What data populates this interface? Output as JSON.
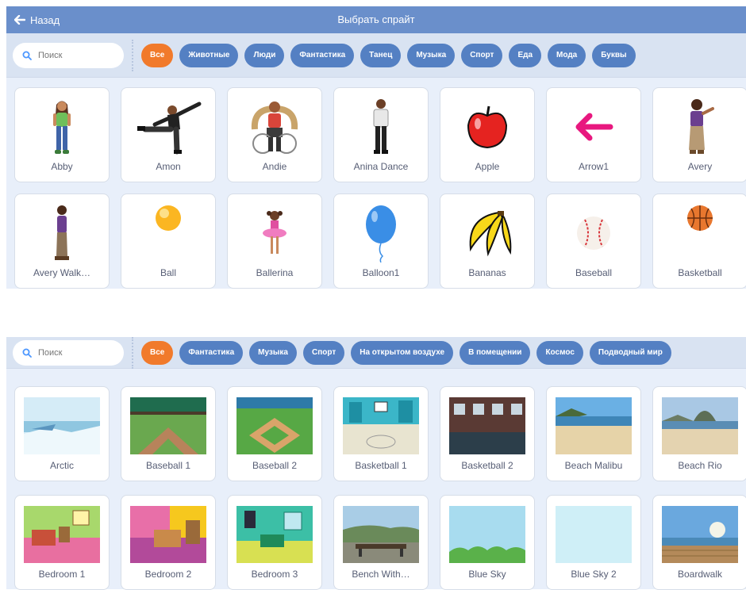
{
  "sprites_panel": {
    "back_label": "Назад",
    "title": "Выбрать спрайт",
    "search_placeholder": "Поиск",
    "tags": [
      "Все",
      "Животные",
      "Люди",
      "Фантастика",
      "Танец",
      "Музыка",
      "Спорт",
      "Еда",
      "Мода",
      "Буквы"
    ],
    "items": [
      "Abby",
      "Amon",
      "Andie",
      "Anina Dance",
      "Apple",
      "Arrow1",
      "Avery",
      "Avery Walk…",
      "Ball",
      "Ballerina",
      "Balloon1",
      "Bananas",
      "Baseball",
      "Basketball"
    ]
  },
  "backdrops_panel": {
    "search_placeholder": "Поиск",
    "tags": [
      "Все",
      "Фантастика",
      "Музыка",
      "Спорт",
      "На открытом воздухе",
      "В помещении",
      "Космос",
      "Подводный мир"
    ],
    "items": [
      "Arctic",
      "Baseball 1",
      "Baseball 2",
      "Basketball 1",
      "Basketball 2",
      "Beach Malibu",
      "Beach Rio",
      "Bedroom 1",
      "Bedroom 2",
      "Bedroom 3",
      "Bench With…",
      "Blue Sky",
      "Blue Sky 2",
      "Boardwalk"
    ]
  },
  "colors": {
    "header": "#6a8fcb",
    "tag": "#5480c3",
    "tag_active": "#f17a2b"
  }
}
